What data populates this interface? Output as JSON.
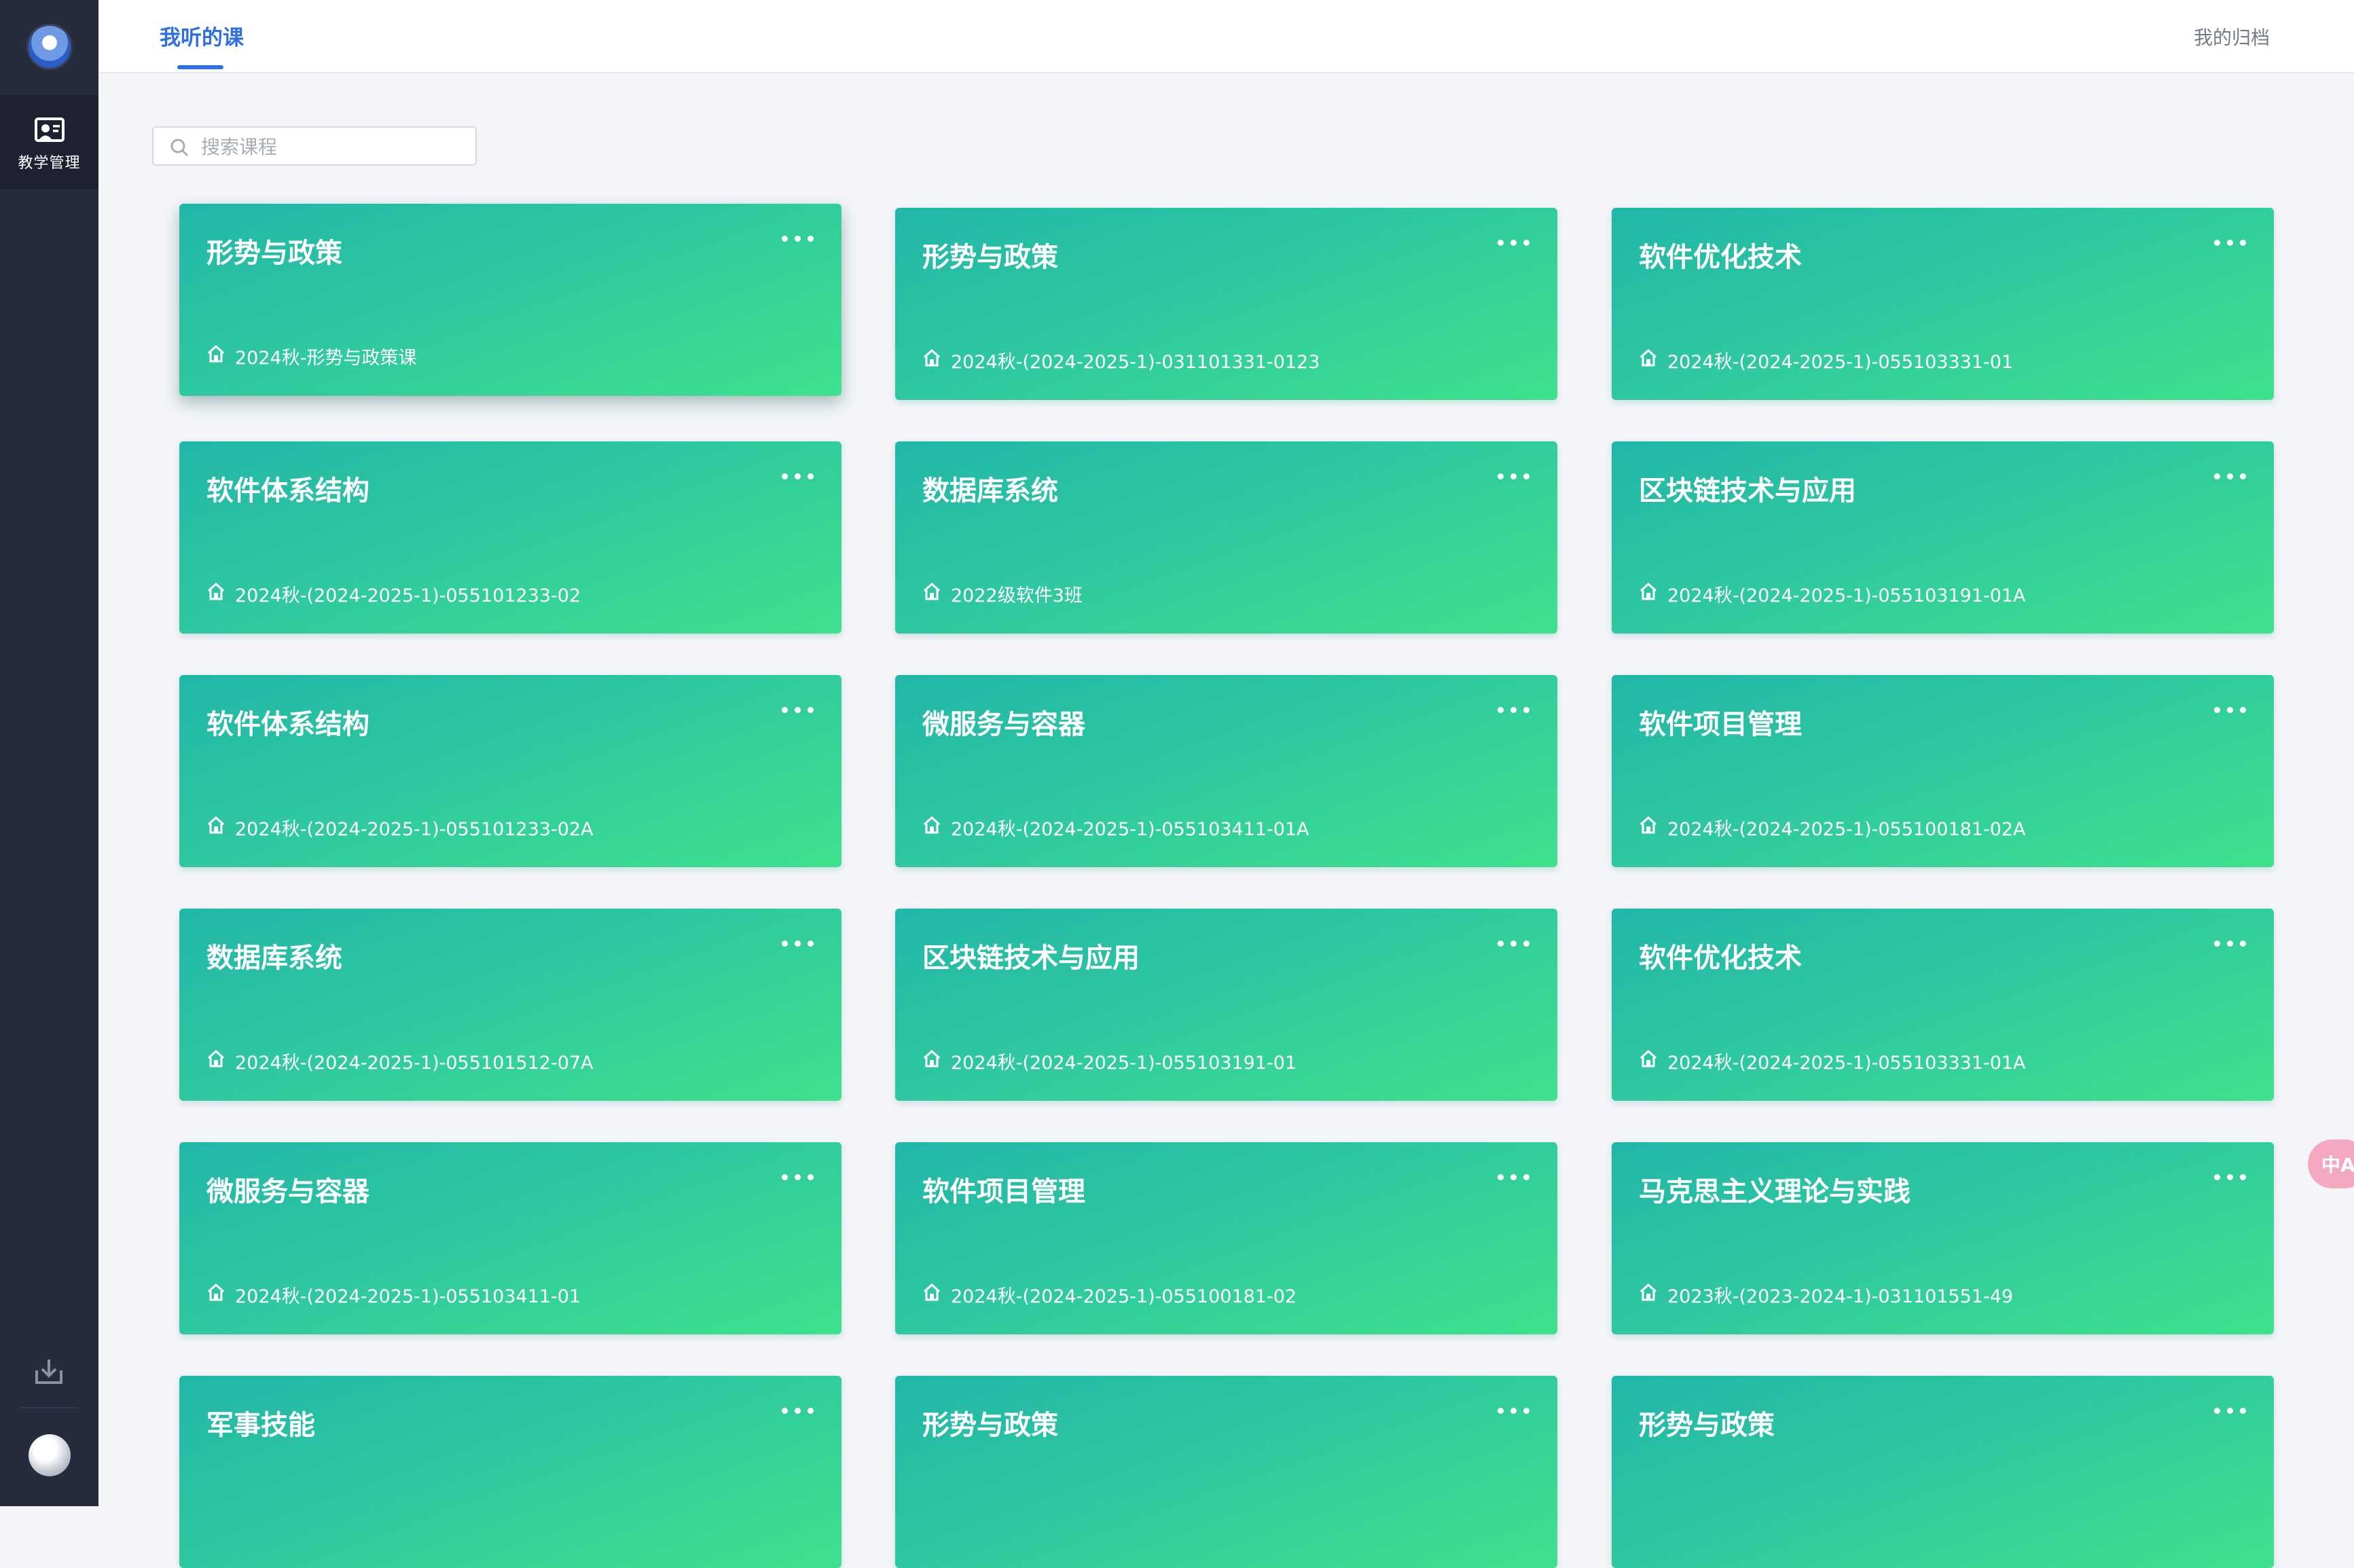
{
  "sidebar": {
    "nav_label": "教学管理",
    "icons": {
      "logo": "school-logo",
      "nav": "teaching-management-icon",
      "download": "download-icon",
      "avatar": "user-avatar"
    }
  },
  "header": {
    "active_tab": "我听的课",
    "archive_link": "我的归档"
  },
  "search": {
    "placeholder": "搜索课程",
    "value": ""
  },
  "colors": {
    "accent": "#2f6fe4",
    "card_gradient_start": "#22b6a8",
    "card_gradient_end": "#3ee28c",
    "sidebar": "#262b3d"
  },
  "courses": [
    {
      "title": "形势与政策",
      "subtitle": "2024秋-形势与政策课"
    },
    {
      "title": "形势与政策",
      "subtitle": "2024秋-(2024-2025-1)-031101331-0123"
    },
    {
      "title": "软件优化技术",
      "subtitle": "2024秋-(2024-2025-1)-055103331-01"
    },
    {
      "title": "软件体系结构",
      "subtitle": "2024秋-(2024-2025-1)-055101233-02"
    },
    {
      "title": "数据库系统",
      "subtitle": "2022级软件3班"
    },
    {
      "title": "区块链技术与应用",
      "subtitle": "2024秋-(2024-2025-1)-055103191-01A"
    },
    {
      "title": "软件体系结构",
      "subtitle": "2024秋-(2024-2025-1)-055101233-02A"
    },
    {
      "title": "微服务与容器",
      "subtitle": "2024秋-(2024-2025-1)-055103411-01A"
    },
    {
      "title": "软件项目管理",
      "subtitle": "2024秋-(2024-2025-1)-055100181-02A"
    },
    {
      "title": "数据库系统",
      "subtitle": "2024秋-(2024-2025-1)-055101512-07A"
    },
    {
      "title": "区块链技术与应用",
      "subtitle": "2024秋-(2024-2025-1)-055103191-01"
    },
    {
      "title": "软件优化技术",
      "subtitle": "2024秋-(2024-2025-1)-055103331-01A"
    },
    {
      "title": "微服务与容器",
      "subtitle": "2024秋-(2024-2025-1)-055103411-01"
    },
    {
      "title": "软件项目管理",
      "subtitle": "2024秋-(2024-2025-1)-055100181-02"
    },
    {
      "title": "马克思主义理论与实践",
      "subtitle": "2023秋-(2023-2024-1)-031101551-49"
    },
    {
      "title": "军事技能",
      "subtitle": ""
    },
    {
      "title": "形势与政策",
      "subtitle": ""
    },
    {
      "title": "形势与政策",
      "subtitle": ""
    }
  ],
  "floating": {
    "translate_label": "中A",
    "icon": "translate-icon"
  }
}
